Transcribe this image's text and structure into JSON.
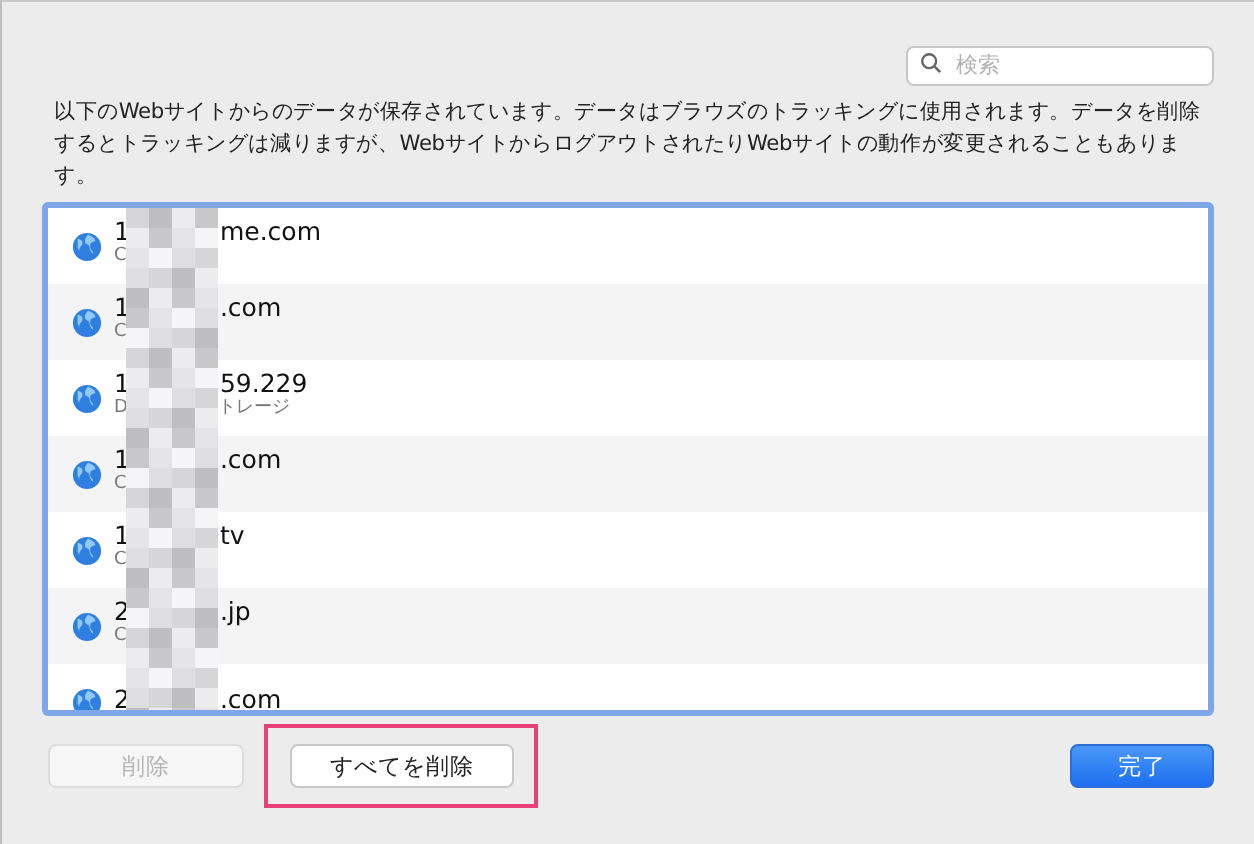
{
  "search": {
    "placeholder": "検索"
  },
  "description": "以下のWebサイトからのデータが保存されています。データはブラウズのトラッキングに使用されます。データを削除するとトラッキングは減りますが、WebサイトからログアウトされたりWebサイトの動作が変更されることもあります。",
  "sites": [
    {
      "name_start": "1",
      "name_end": "me.com",
      "detail_start": "C",
      "selected": false
    },
    {
      "name_start": "1",
      "name_end": ".com",
      "detail_start": "C",
      "selected": false
    },
    {
      "name_start": "1",
      "name_end": "59.229",
      "detail_start": "D",
      "detail_end": "トレージ",
      "selected": false
    },
    {
      "name_start": "1",
      "name_end": ".com",
      "detail_start": "C",
      "selected": false
    },
    {
      "name_start": "1",
      "name_end": "tv",
      "detail_start": "C",
      "selected": false
    },
    {
      "name_start": "2",
      "name_end": ".jp",
      "detail_start": "C",
      "selected": false
    },
    {
      "name_start": "2",
      "name_end": ".com",
      "selected": false
    }
  ],
  "buttons": [
    {
      "label": "削除",
      "kind": "secondary",
      "disabled": true,
      "highlighted": false
    },
    {
      "label": "すべてを削除",
      "kind": "secondary",
      "disabled": false,
      "highlighted": true
    },
    {
      "label": "完了",
      "kind": "primary",
      "disabled": false,
      "highlighted": false
    }
  ]
}
